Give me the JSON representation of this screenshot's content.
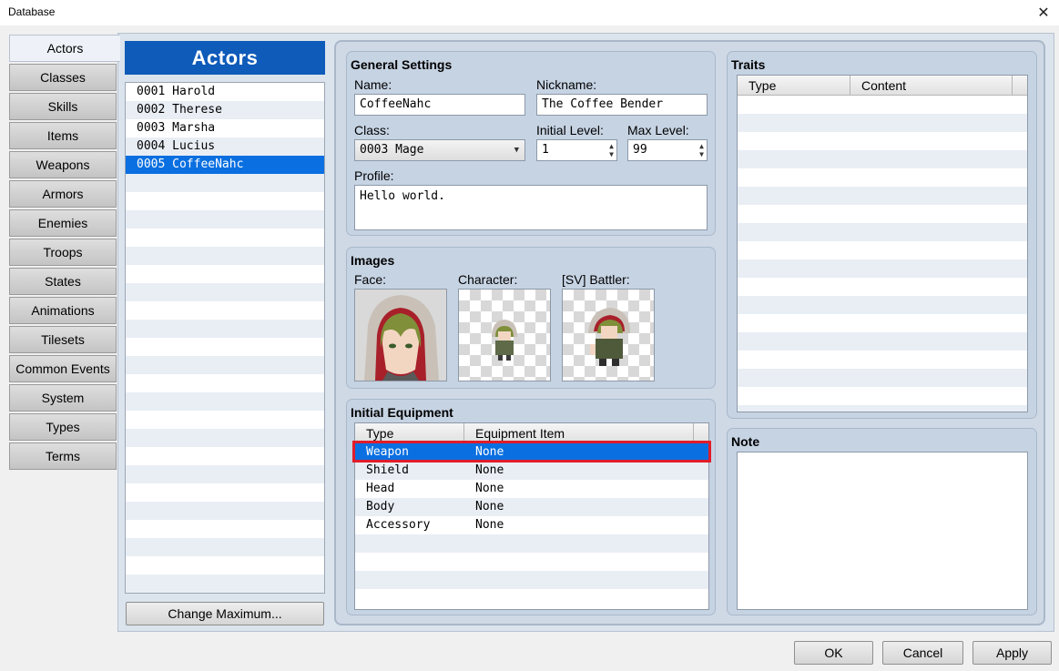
{
  "window": {
    "title": "Database"
  },
  "tabs": [
    "Actors",
    "Classes",
    "Skills",
    "Items",
    "Weapons",
    "Armors",
    "Enemies",
    "Troops",
    "States",
    "Animations",
    "Tilesets",
    "Common Events",
    "System",
    "Types",
    "Terms"
  ],
  "active_tab": "Actors",
  "actor_list": {
    "header": "Actors",
    "items": [
      "0001 Harold",
      "0002 Therese",
      "0003 Marsha",
      "0004 Lucius",
      "0005 CoffeeNahc"
    ],
    "selected_index": 4,
    "change_max_label": "Change Maximum..."
  },
  "general": {
    "title": "General Settings",
    "name_label": "Name:",
    "name_value": "CoffeeNahc",
    "nickname_label": "Nickname:",
    "nickname_value": "The Coffee Bender",
    "class_label": "Class:",
    "class_value": "0003 Mage",
    "initial_level_label": "Initial Level:",
    "initial_level_value": "1",
    "max_level_label": "Max Level:",
    "max_level_value": "99",
    "profile_label": "Profile:",
    "profile_value": "Hello world."
  },
  "images": {
    "title": "Images",
    "face_label": "Face:",
    "character_label": "Character:",
    "battler_label": "[SV] Battler:"
  },
  "equipment": {
    "title": "Initial Equipment",
    "col_type": "Type",
    "col_item": "Equipment Item",
    "rows": [
      {
        "type": "Weapon",
        "item": "None"
      },
      {
        "type": "Shield",
        "item": "None"
      },
      {
        "type": "Head",
        "item": "None"
      },
      {
        "type": "Body",
        "item": "None"
      },
      {
        "type": "Accessory",
        "item": "None"
      }
    ],
    "selected_index": 0
  },
  "traits": {
    "title": "Traits",
    "col_type": "Type",
    "col_content": "Content"
  },
  "note": {
    "title": "Note"
  },
  "buttons": {
    "ok": "OK",
    "cancel": "Cancel",
    "apply": "Apply"
  },
  "colors": {
    "accent": "#0e5bb9",
    "selection": "#0a6fe0",
    "highlight_box": "#e11d2a"
  }
}
